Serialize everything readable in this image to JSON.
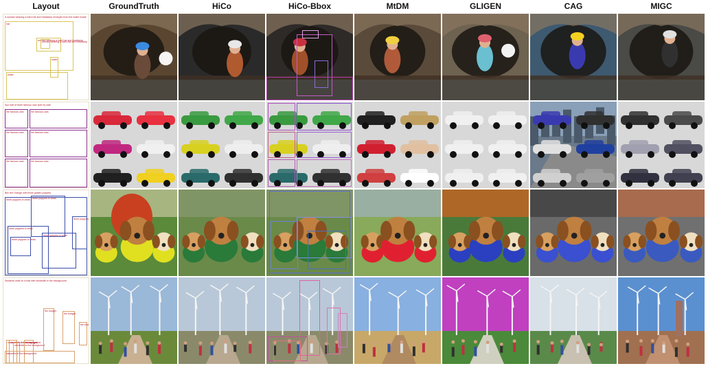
{
  "headers": [
    "Layout",
    "GroundTruth",
    "HiCo",
    "HiCo-Bbox",
    "MtDM",
    "GLIGEN",
    "CAG",
    "MIGC"
  ],
  "rows": [
    {
      "caption": "A woman wearing a hard hat and headlamp emerges from the water inside",
      "labels": [
        "woman wearing a hard hat and headlamp",
        "hat",
        "water"
      ],
      "color": "#d9c35a",
      "text_color": "#b81d2e",
      "scene": "cave"
    },
    {
      "caption": "four half of three famous cars side by side",
      "labels": [
        "the famous cars",
        "the famous cars",
        "the famous cars",
        "the famous cars",
        "the famous cars",
        "the famous cars"
      ],
      "color": "#8a2a8c",
      "text_color": "#b81d2e",
      "scene": "cars"
    },
    {
      "caption": "Bev the Orange with three golden puppies",
      "labels": [
        "three puppies in vests",
        "three puppies in vests",
        "three puppies in vests"
      ],
      "color": "#3b4ea8",
      "text_color": "#b81d2e",
      "scene": "puppies"
    },
    {
      "caption": "Students walk on a trail with windmills in the background",
      "labels": [
        "windmills in the background",
        "the budget"
      ],
      "color": "#d9a06a",
      "text_color": "#b81d2e",
      "scene": "windmills"
    }
  ]
}
